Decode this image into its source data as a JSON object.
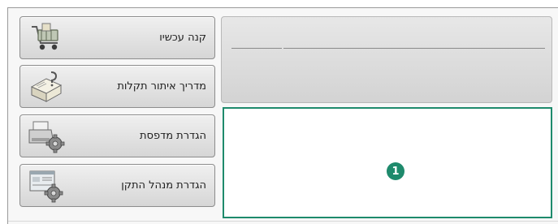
{
  "menu": {
    "items": [
      {
        "label": "קנה עכשיו",
        "icon": "shopping-cart-icon"
      },
      {
        "label": "מדריך איתור תקלות",
        "icon": "troubleshooting-book-icon"
      },
      {
        "label": "הגדרת מדפסת",
        "icon": "printer-gear-icon"
      },
      {
        "label": "הגדרת מנהל התקן",
        "icon": "driver-window-gear-icon"
      }
    ]
  },
  "content": {
    "callout_number": "1"
  },
  "colors": {
    "accent": "#1e8a6c",
    "button_top": "#f0f0f0",
    "button_bottom": "#d6d6d6",
    "panel": "#dcdcdc"
  }
}
